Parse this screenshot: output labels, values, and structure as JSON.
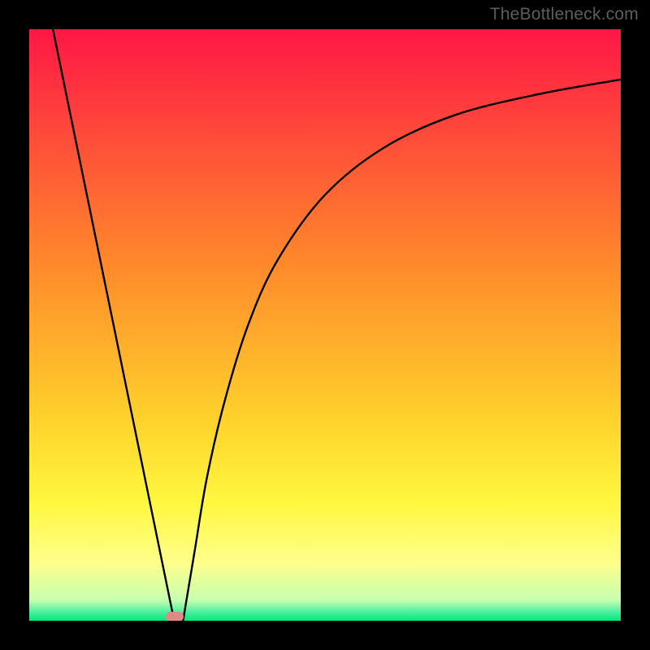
{
  "watermark": "TheBottleneck.com",
  "colors": {
    "frame": "#000000",
    "top": "#ff1745",
    "mid": "#ffbf2b",
    "yellow_band": "#ffff66",
    "green": "#00e778",
    "curve": "#000000",
    "marker": "#dd8a84"
  },
  "chart_data": {
    "type": "line",
    "title": "",
    "xlabel": "",
    "ylabel": "",
    "xlim": [
      0,
      100
    ],
    "ylim": [
      0,
      100
    ],
    "grid": false,
    "legend": false,
    "series": [
      {
        "name": "left-line",
        "x": [
          4,
          24.5
        ],
        "y": [
          100,
          0
        ]
      },
      {
        "name": "right-curve",
        "x": [
          26,
          28,
          30,
          33,
          37,
          42,
          50,
          60,
          72,
          86,
          100
        ],
        "y": [
          0,
          12,
          24,
          37,
          50,
          61,
          72,
          80,
          85.5,
          89,
          91.5
        ]
      }
    ],
    "marker": {
      "x": 24.6,
      "y": 0.7
    },
    "gradient_bands": [
      {
        "pos": 0.0,
        "color": "#ff1745"
      },
      {
        "pos": 0.4,
        "color": "#ff8a2b"
      },
      {
        "pos": 0.66,
        "color": "#ffd22b"
      },
      {
        "pos": 0.8,
        "color": "#fff73f"
      },
      {
        "pos": 0.9,
        "color": "#ffff8a"
      },
      {
        "pos": 0.965,
        "color": "#c8ffb0"
      },
      {
        "pos": 0.985,
        "color": "#4cf0a0"
      },
      {
        "pos": 1.0,
        "color": "#00e778"
      }
    ]
  }
}
